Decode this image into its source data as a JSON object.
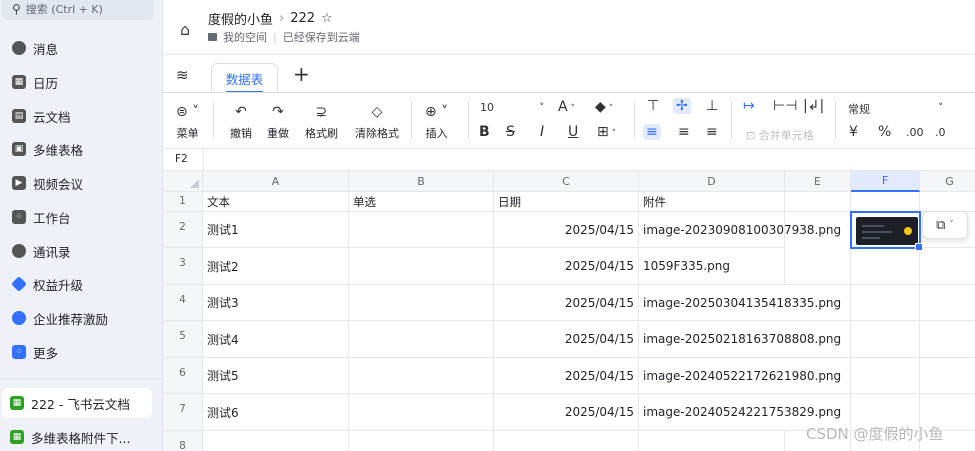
{
  "sidebar": {
    "search_placeholder": "搜索 (Ctrl + K)",
    "items": [
      {
        "label": "消息",
        "icon": "message-icon",
        "color": "#444"
      },
      {
        "label": "日历",
        "icon": "calendar-icon",
        "color": "#444"
      },
      {
        "label": "云文档",
        "icon": "docs-icon",
        "color": "#444"
      },
      {
        "label": "多维表格",
        "icon": "base-icon",
        "color": "#444"
      },
      {
        "label": "视频会议",
        "icon": "video-icon",
        "color": "#444"
      },
      {
        "label": "工作台",
        "icon": "workplace-icon",
        "color": "#444"
      },
      {
        "label": "通讯录",
        "icon": "contacts-icon",
        "color": "#444"
      },
      {
        "label": "权益升级",
        "icon": "upgrade-icon",
        "color": "#3370ff"
      },
      {
        "label": "企业推荐激励",
        "icon": "referral-icon",
        "color": "#3370ff"
      },
      {
        "label": "更多",
        "icon": "more-apps-icon",
        "color": "#3370ff"
      }
    ],
    "recent_docs": [
      {
        "label": "222 - 飞书云文档",
        "active": true
      },
      {
        "label": "多维表格附件下..."
      }
    ]
  },
  "header": {
    "breadcrumb_parent": "度假的小鱼",
    "doc_title": "222",
    "location": "我的空间",
    "save_status": "已经保存到云端"
  },
  "tabs": [
    {
      "label": "数据表",
      "active": true
    }
  ],
  "toolbar": {
    "menu_label": "菜单",
    "undo_label": "撤销",
    "redo_label": "重做",
    "format_painter_label": "格式刷",
    "clear_format_label": "清除格式",
    "insert_label": "插入",
    "font_size": "10",
    "merge_cells_label": "合并单元格",
    "number_format": "常规"
  },
  "formula_bar": {
    "cell_ref": "F2"
  },
  "grid": {
    "columns": [
      "A",
      "B",
      "C",
      "D",
      "E",
      "F",
      "G"
    ],
    "selected_column": "F",
    "row_numbers": [
      "1",
      "2",
      "3",
      "4",
      "5",
      "6",
      "7",
      "8"
    ],
    "header_row": [
      "文本",
      "单选",
      "日期",
      "附件"
    ],
    "rows": [
      {
        "text": "测试1",
        "date": "2025/04/15",
        "attachment": "image-20230908100307938.png"
      },
      {
        "text": "测试2",
        "date": "2025/04/15",
        "attachment": "1059F335.png"
      },
      {
        "text": "测试3",
        "date": "2025/04/15",
        "attachment": "image-20250304135418335.png"
      },
      {
        "text": "测试4",
        "date": "2025/04/15",
        "attachment": "image-20250218163708808.png"
      },
      {
        "text": "测试5",
        "date": "2025/04/15",
        "attachment": "image-20240522172621980.png"
      },
      {
        "text": "测试6",
        "date": "2025/04/15",
        "attachment": "image-20240524221753829.png"
      }
    ]
  },
  "watermark": "CSDN @度假的小鱼"
}
